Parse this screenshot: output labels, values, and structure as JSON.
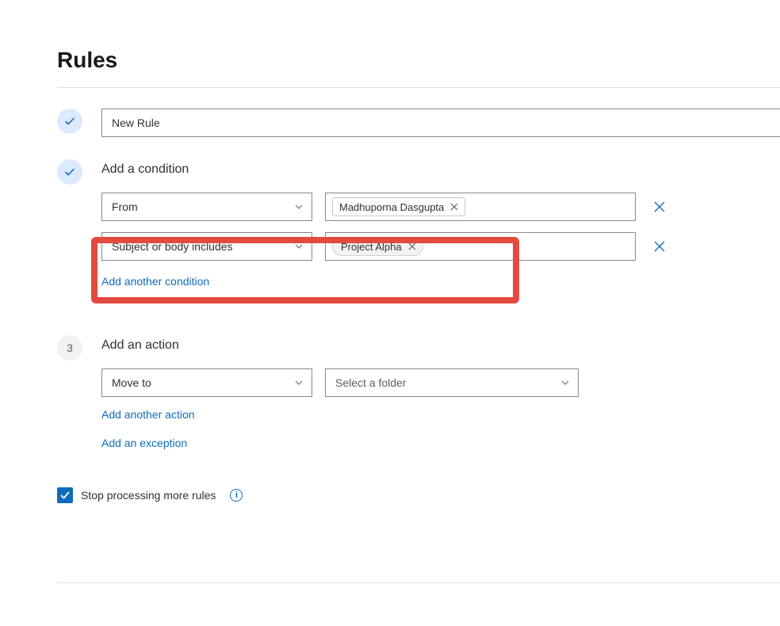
{
  "page": {
    "title": "Rules"
  },
  "rule": {
    "name": "New Rule"
  },
  "conditions": {
    "title": "Add a condition",
    "row1_type": "From",
    "row1_chip": "Madhuporna Dasgupta",
    "row2_type": "Subject or body includes",
    "row2_chip": "Project Alpha",
    "add_another": "Add another condition"
  },
  "actions": {
    "step_number": "3",
    "title": "Add an action",
    "type": "Move to",
    "folder_placeholder": "Select a folder",
    "add_another": "Add another action",
    "add_exception": "Add an exception"
  },
  "stop": {
    "label": "Stop processing more rules"
  }
}
